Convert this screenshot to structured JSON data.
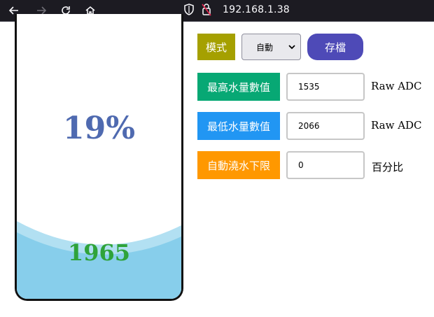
{
  "browser": {
    "url": "192.168.1.38",
    "icons": [
      "back-arrow-icon",
      "forward-arrow-icon",
      "reload-icon",
      "home-icon",
      "shield-icon",
      "lock-warning-icon"
    ]
  },
  "tank": {
    "percent_text": "19%",
    "raw_value_text": "1965",
    "fill_level": 0.19,
    "colors": {
      "water": "#87ceeb",
      "percent": "#4f6ab0",
      "raw": "#2fa33a"
    }
  },
  "controls": {
    "mode_label": "模式",
    "mode_value": "自動",
    "save_label": "存檔",
    "max_label": "最高水量數值",
    "max_value": "1535",
    "max_unit": "Raw ADC",
    "min_label": "最低水量數值",
    "min_value": "2066",
    "min_unit": "Raw ADC",
    "auto_label": "自動澆水下限",
    "auto_value": "0",
    "auto_unit": "百分比",
    "colors": {
      "mode": "#a5a000",
      "max": "#07a874",
      "min": "#2196f3",
      "auto": "#ff9800",
      "save": "#4e4ab7"
    }
  }
}
